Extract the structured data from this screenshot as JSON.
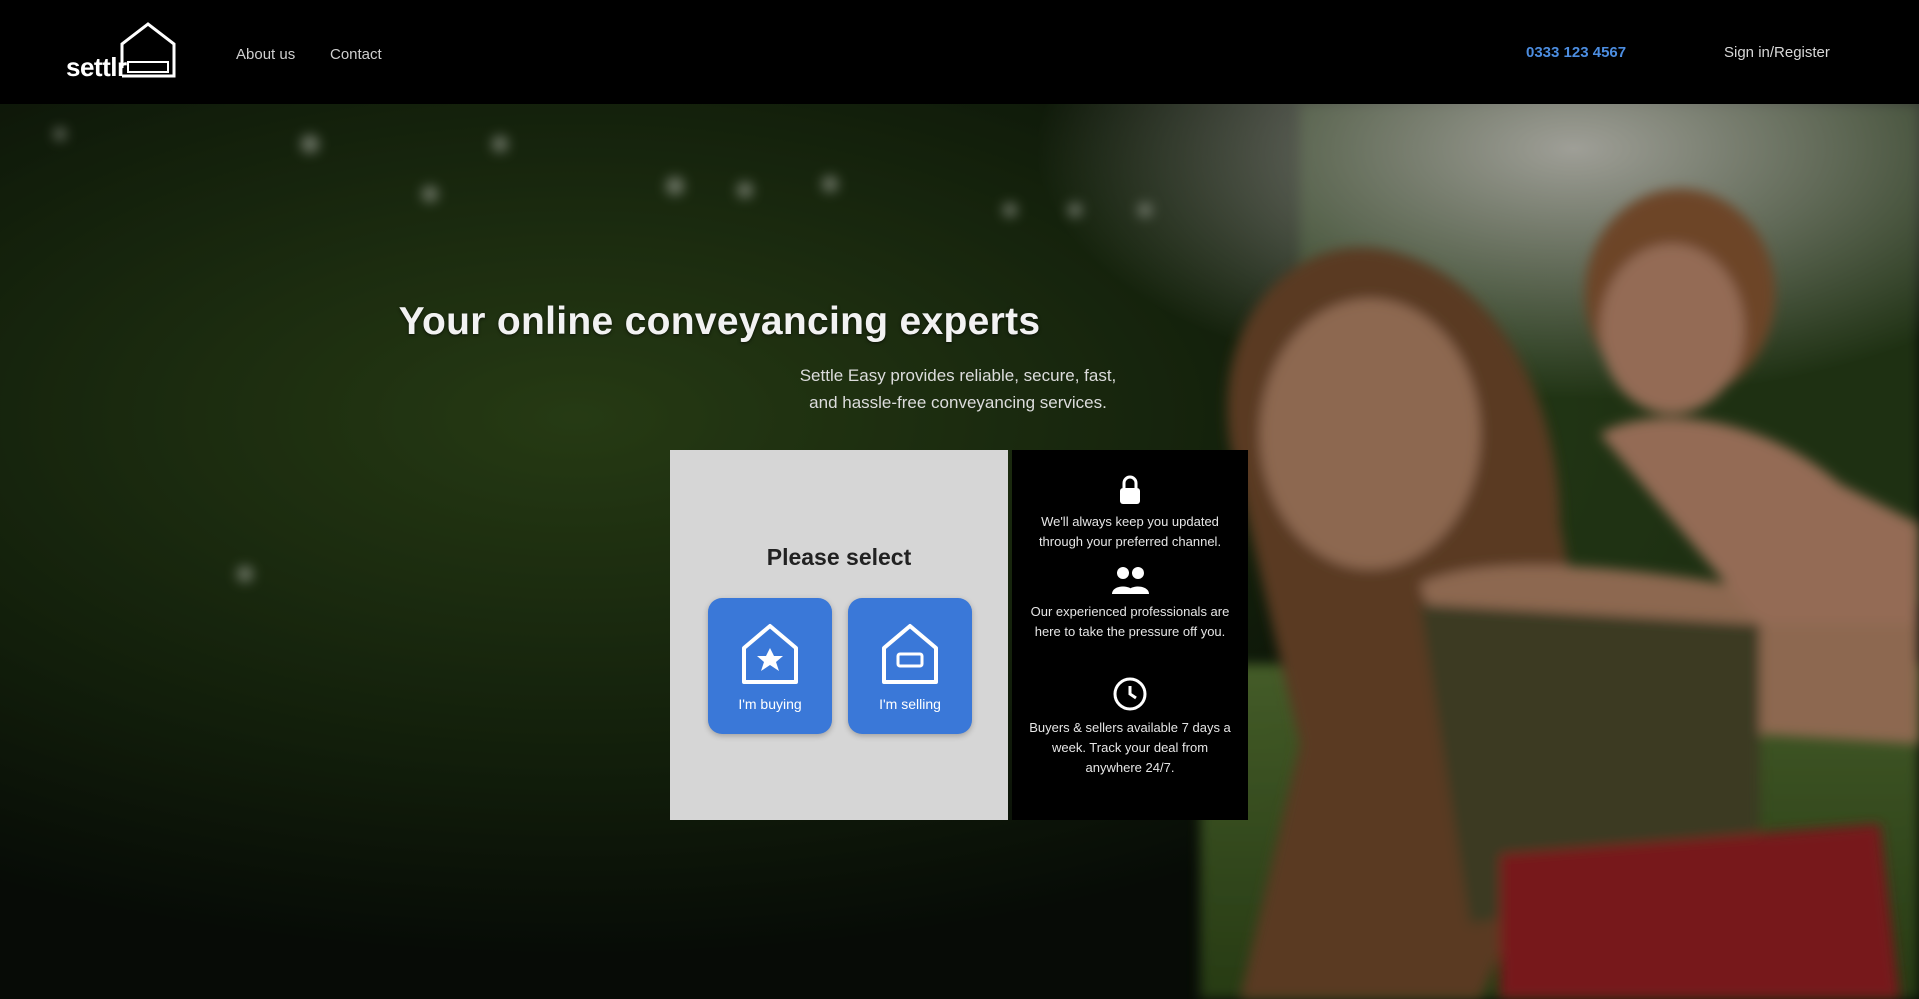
{
  "header": {
    "logo_text": "settlr",
    "nav": [
      "About us",
      "Contact"
    ],
    "phone": "0333 123 4567",
    "login": "Sign in/Register"
  },
  "hero": {
    "title": "Your online conveyancing experts",
    "subtitle_line1": "Settle Easy provides reliable, secure, fast,",
    "subtitle_line2": "and hassle-free conveyancing services."
  },
  "select": {
    "title": "Please select",
    "options": [
      {
        "label": "I'm buying",
        "icon": "house-buy-icon"
      },
      {
        "label": "I'm selling",
        "icon": "house-sell-icon"
      }
    ]
  },
  "info": [
    {
      "icon": "lock-icon",
      "text": "We'll always keep you updated through your preferred channel."
    },
    {
      "icon": "people-icon",
      "text": "Our experienced professionals are here to take the pressure off you."
    },
    {
      "icon": "clock-icon",
      "text": "Buyers & sellers available 7 days a week. Track your deal from anywhere 24/7."
    }
  ],
  "colors": {
    "accent": "#3a78d8",
    "header_bg": "#000000",
    "panel_bg": "#d6d6d6"
  }
}
